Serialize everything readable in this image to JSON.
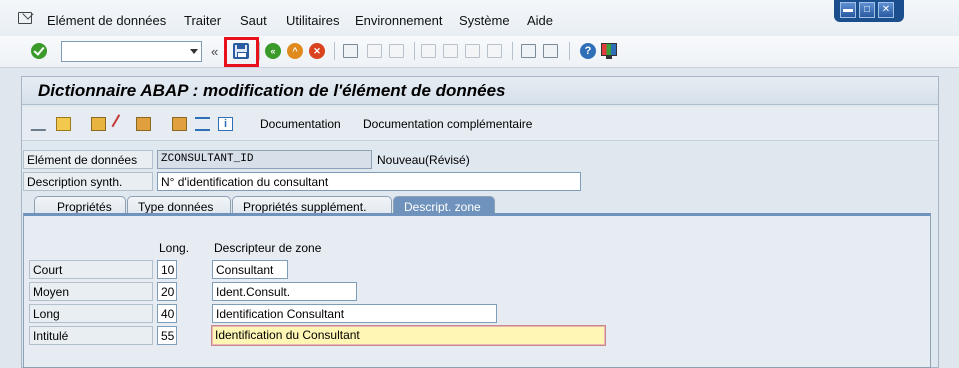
{
  "menubar": {
    "items": [
      "Elément de données",
      "Traiter",
      "Saut",
      "Utilitaires",
      "Environnement",
      "Système",
      "Aide"
    ]
  },
  "window_controls": {
    "minimize": "▬",
    "maximize": "□",
    "close": "✕"
  },
  "std_toolbar": {
    "command_field": {
      "value": "",
      "placeholder": ""
    },
    "collapse_glyph": "«",
    "highlight_color": "#e8101a"
  },
  "page": {
    "title": "Dictionnaire ABAP : modification de l'élément de données"
  },
  "app_toolbar": {
    "documentation": "Documentation",
    "documentation_extra": "Documentation complémentaire"
  },
  "header_fields": {
    "element_label": "Elément de données",
    "element_value": "ZCONSULTANT_ID",
    "element_status": "Nouveau(Révisé)",
    "desc_label": "Description synth.",
    "desc_value": "N° d'identification du consultant"
  },
  "tabs": [
    "Propriétés",
    "Type données",
    "Propriétés supplément.",
    "Descript. zone"
  ],
  "active_tab": "Descript. zone",
  "field_labels": {
    "len_header": "Long.",
    "desc_header": "Descripteur de zone",
    "rows": [
      {
        "label": "Court",
        "length": "10",
        "text": "Consultant"
      },
      {
        "label": "Moyen",
        "length": "20",
        "text": "Ident.Consult."
      },
      {
        "label": "Long",
        "length": "40",
        "text": "Identification Consultant"
      },
      {
        "label": "Intitulé",
        "length": "55",
        "text": "Identification du Consultant"
      }
    ]
  }
}
